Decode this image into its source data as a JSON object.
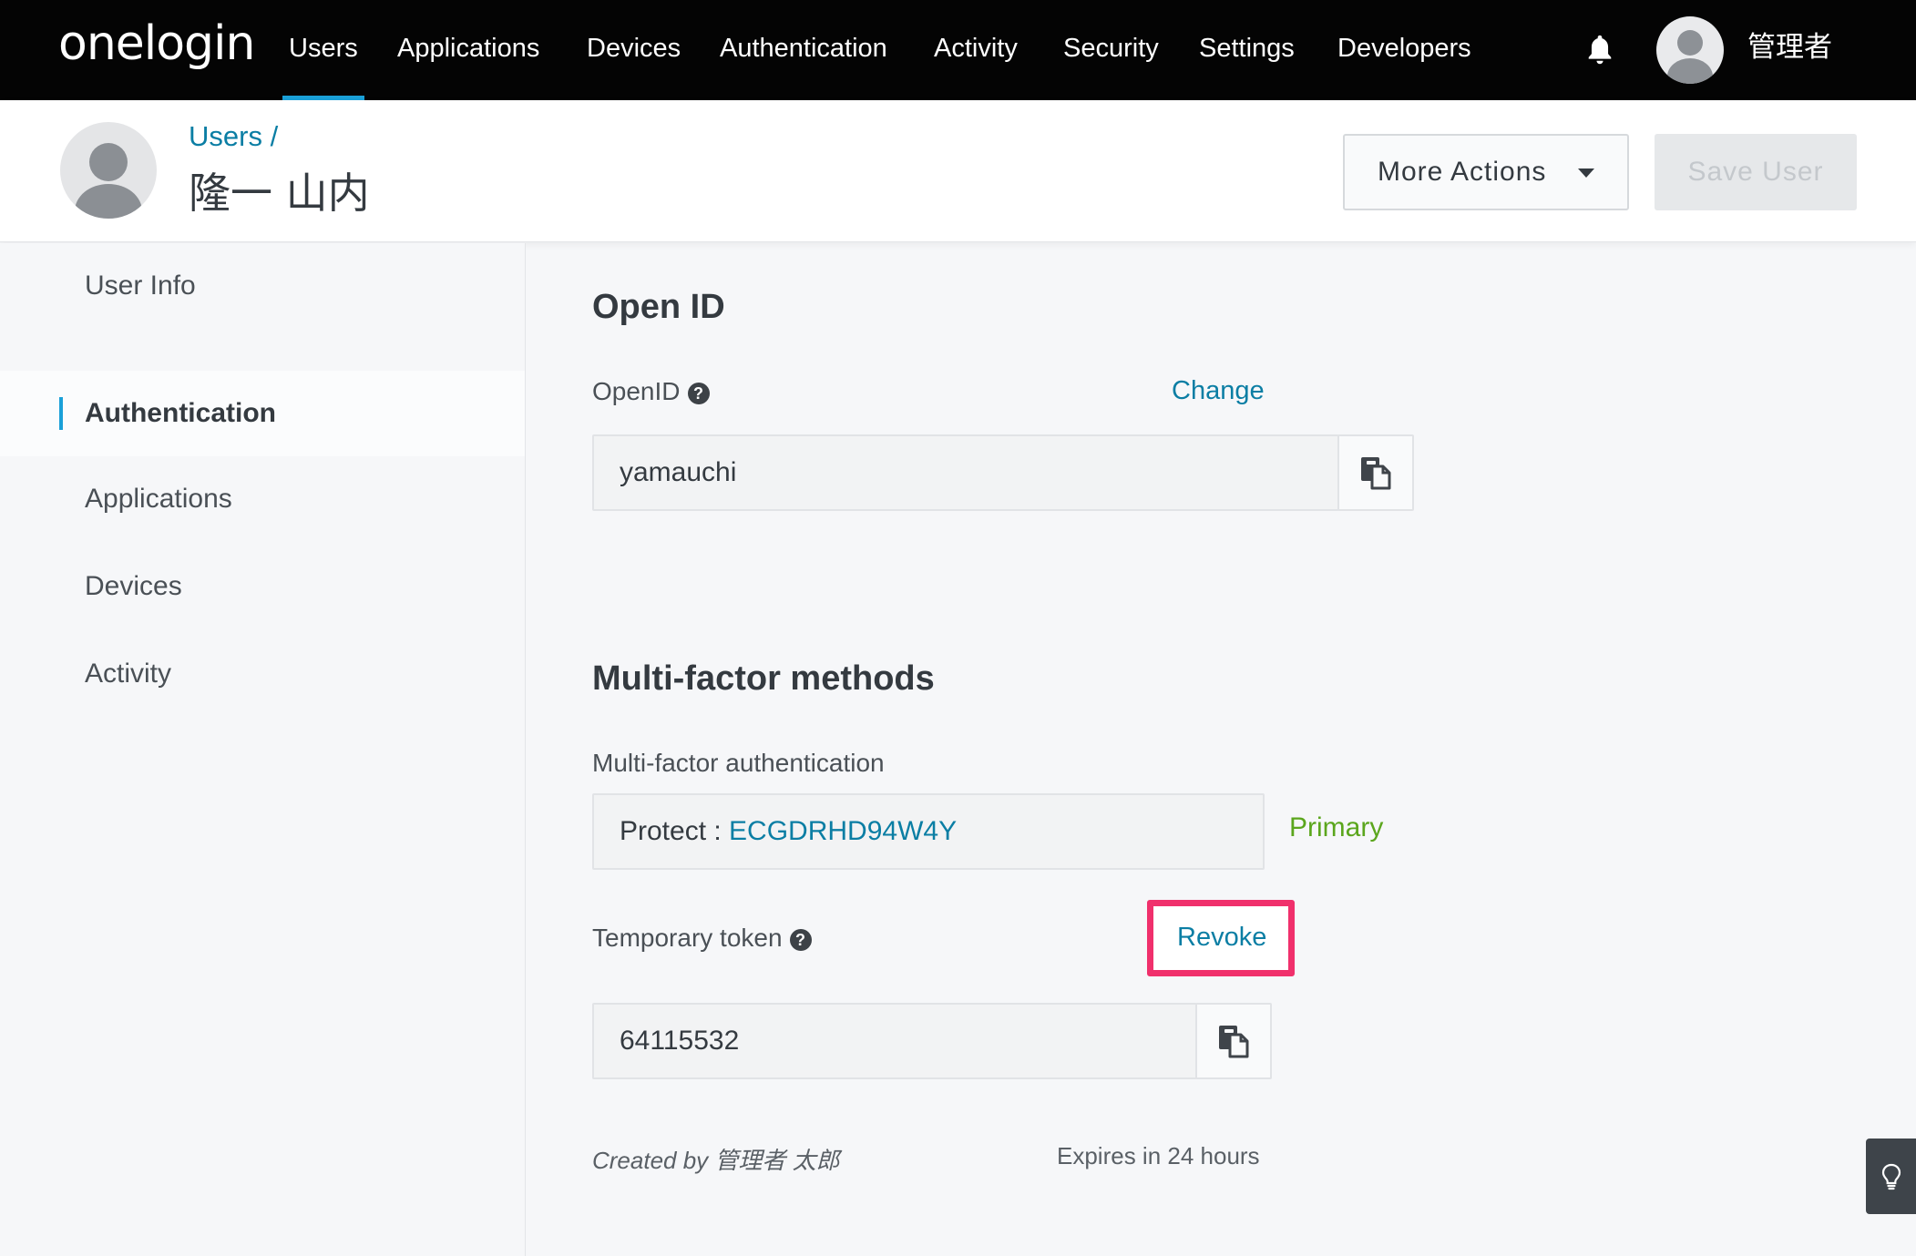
{
  "app": {
    "logo": "onelogin",
    "nav": [
      {
        "label": "Users",
        "active": true
      },
      {
        "label": "Applications"
      },
      {
        "label": "Devices"
      },
      {
        "label": "Authentication"
      },
      {
        "label": "Activity"
      },
      {
        "label": "Security"
      },
      {
        "label": "Settings"
      },
      {
        "label": "Developers"
      }
    ],
    "bell_icon": "bell-icon",
    "avatar_icon": "user-avatar-icon",
    "username": "管理者"
  },
  "header": {
    "breadcrumb": "Users /",
    "title": "隆一 山内",
    "more_actions": "More Actions",
    "save_user": "Save User"
  },
  "sidebar": {
    "items": [
      {
        "label": "User Info"
      },
      {
        "label": "Authentication",
        "active": true
      },
      {
        "label": "Applications"
      },
      {
        "label": "Devices"
      },
      {
        "label": "Activity"
      }
    ]
  },
  "openid": {
    "section_title": "Open ID",
    "label": "OpenID",
    "change_link": "Change",
    "value": "yamauchi",
    "copy_icon": "copy-icon"
  },
  "mfa": {
    "section_title": "Multi-factor methods",
    "label": "Multi-factor authentication",
    "device_prefix": "Protect : ",
    "device_id": "ECGDRHD94W4Y",
    "primary": "Primary",
    "temp_token_label": "Temporary token",
    "revoke_link": "Revoke",
    "token_value": "64115532",
    "created_by": "Created by 管理者 太郎",
    "expires": "Expires in 24 hours"
  },
  "colors": {
    "nav_bg": "#040404",
    "accent": "#1aa0d8",
    "link": "#0b7ea4",
    "primary_green": "#5ba61d",
    "highlight": "#f0306c"
  },
  "help_tab_icon": "lightbulb-icon"
}
